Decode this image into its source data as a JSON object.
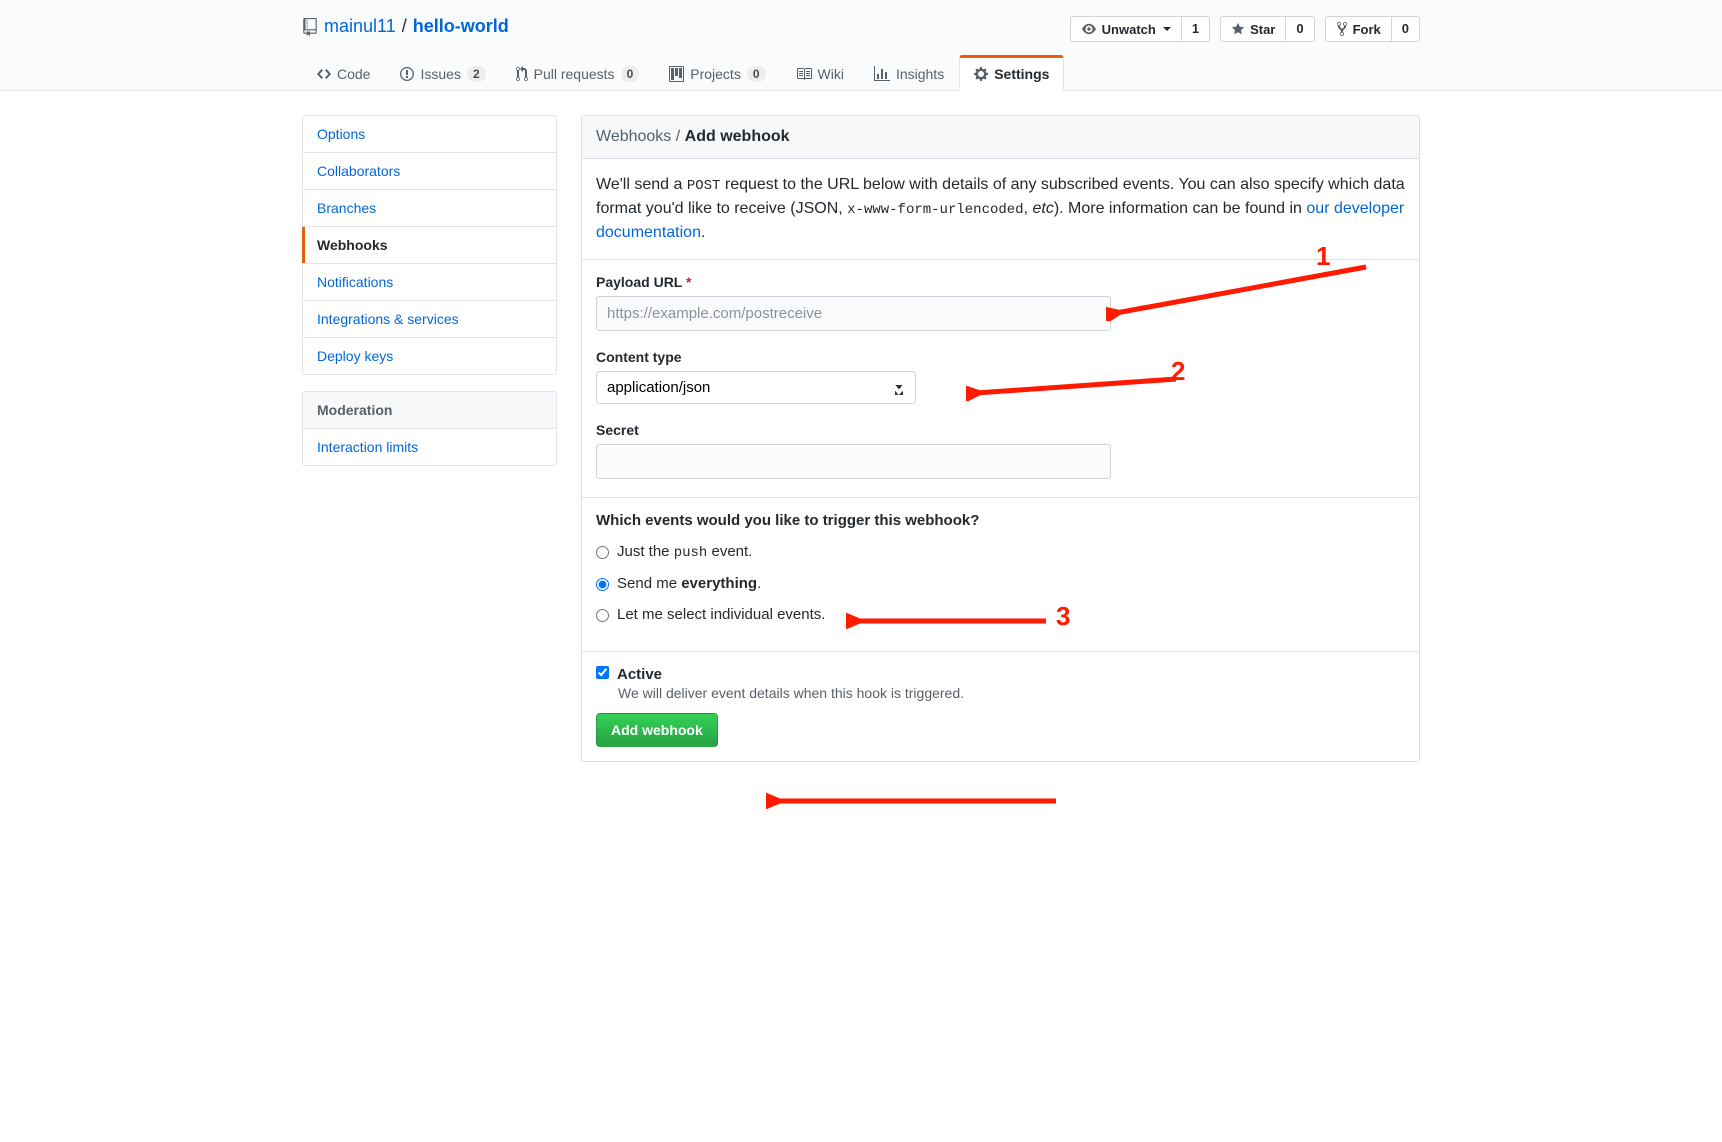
{
  "repo": {
    "owner": "mainul11",
    "name": "hello-world",
    "sep": "/"
  },
  "actions": {
    "unwatch": {
      "label": "Unwatch",
      "count": "1"
    },
    "star": {
      "label": "Star",
      "count": "0"
    },
    "fork": {
      "label": "Fork",
      "count": "0"
    }
  },
  "tabs": {
    "code": "Code",
    "issues": "Issues",
    "issues_count": "2",
    "pulls": "Pull requests",
    "pulls_count": "0",
    "projects": "Projects",
    "projects_count": "0",
    "wiki": "Wiki",
    "insights": "Insights",
    "settings": "Settings"
  },
  "sidebar": {
    "items": [
      "Options",
      "Collaborators",
      "Branches",
      "Webhooks",
      "Notifications",
      "Integrations & services",
      "Deploy keys"
    ],
    "moderation_heading": "Moderation",
    "moderation_items": [
      "Interaction limits"
    ]
  },
  "page": {
    "breadcrumb_root": "Webhooks",
    "breadcrumb_sep": " / ",
    "breadcrumb_current": "Add webhook",
    "intro_a": "We'll send a ",
    "intro_code1": "POST",
    "intro_b": " request to the URL below with details of any subscribed events. You can also specify which data format you'd like to receive (JSON, ",
    "intro_code2": "x-www-form-urlencoded",
    "intro_c": ", ",
    "intro_em": "etc",
    "intro_d": "). More information can be found in ",
    "intro_link": "our developer documentation",
    "intro_e": "."
  },
  "form": {
    "payload_label": "Payload URL",
    "payload_placeholder": "https://example.com/postreceive",
    "content_type_label": "Content type",
    "content_type_value": "application/json",
    "secret_label": "Secret",
    "events_question": "Which events would you like to trigger this webhook?",
    "event_push_a": "Just the ",
    "event_push_code": "push",
    "event_push_b": " event.",
    "event_everything_a": "Send me ",
    "event_everything_strong": "everything",
    "event_everything_b": ".",
    "event_select": "Let me select individual events.",
    "active_label": "Active",
    "active_note": "We will deliver event details when this hook is triggered.",
    "submit": "Add webhook"
  },
  "annotations": {
    "n1": "1",
    "n2": "2",
    "n3": "3"
  }
}
